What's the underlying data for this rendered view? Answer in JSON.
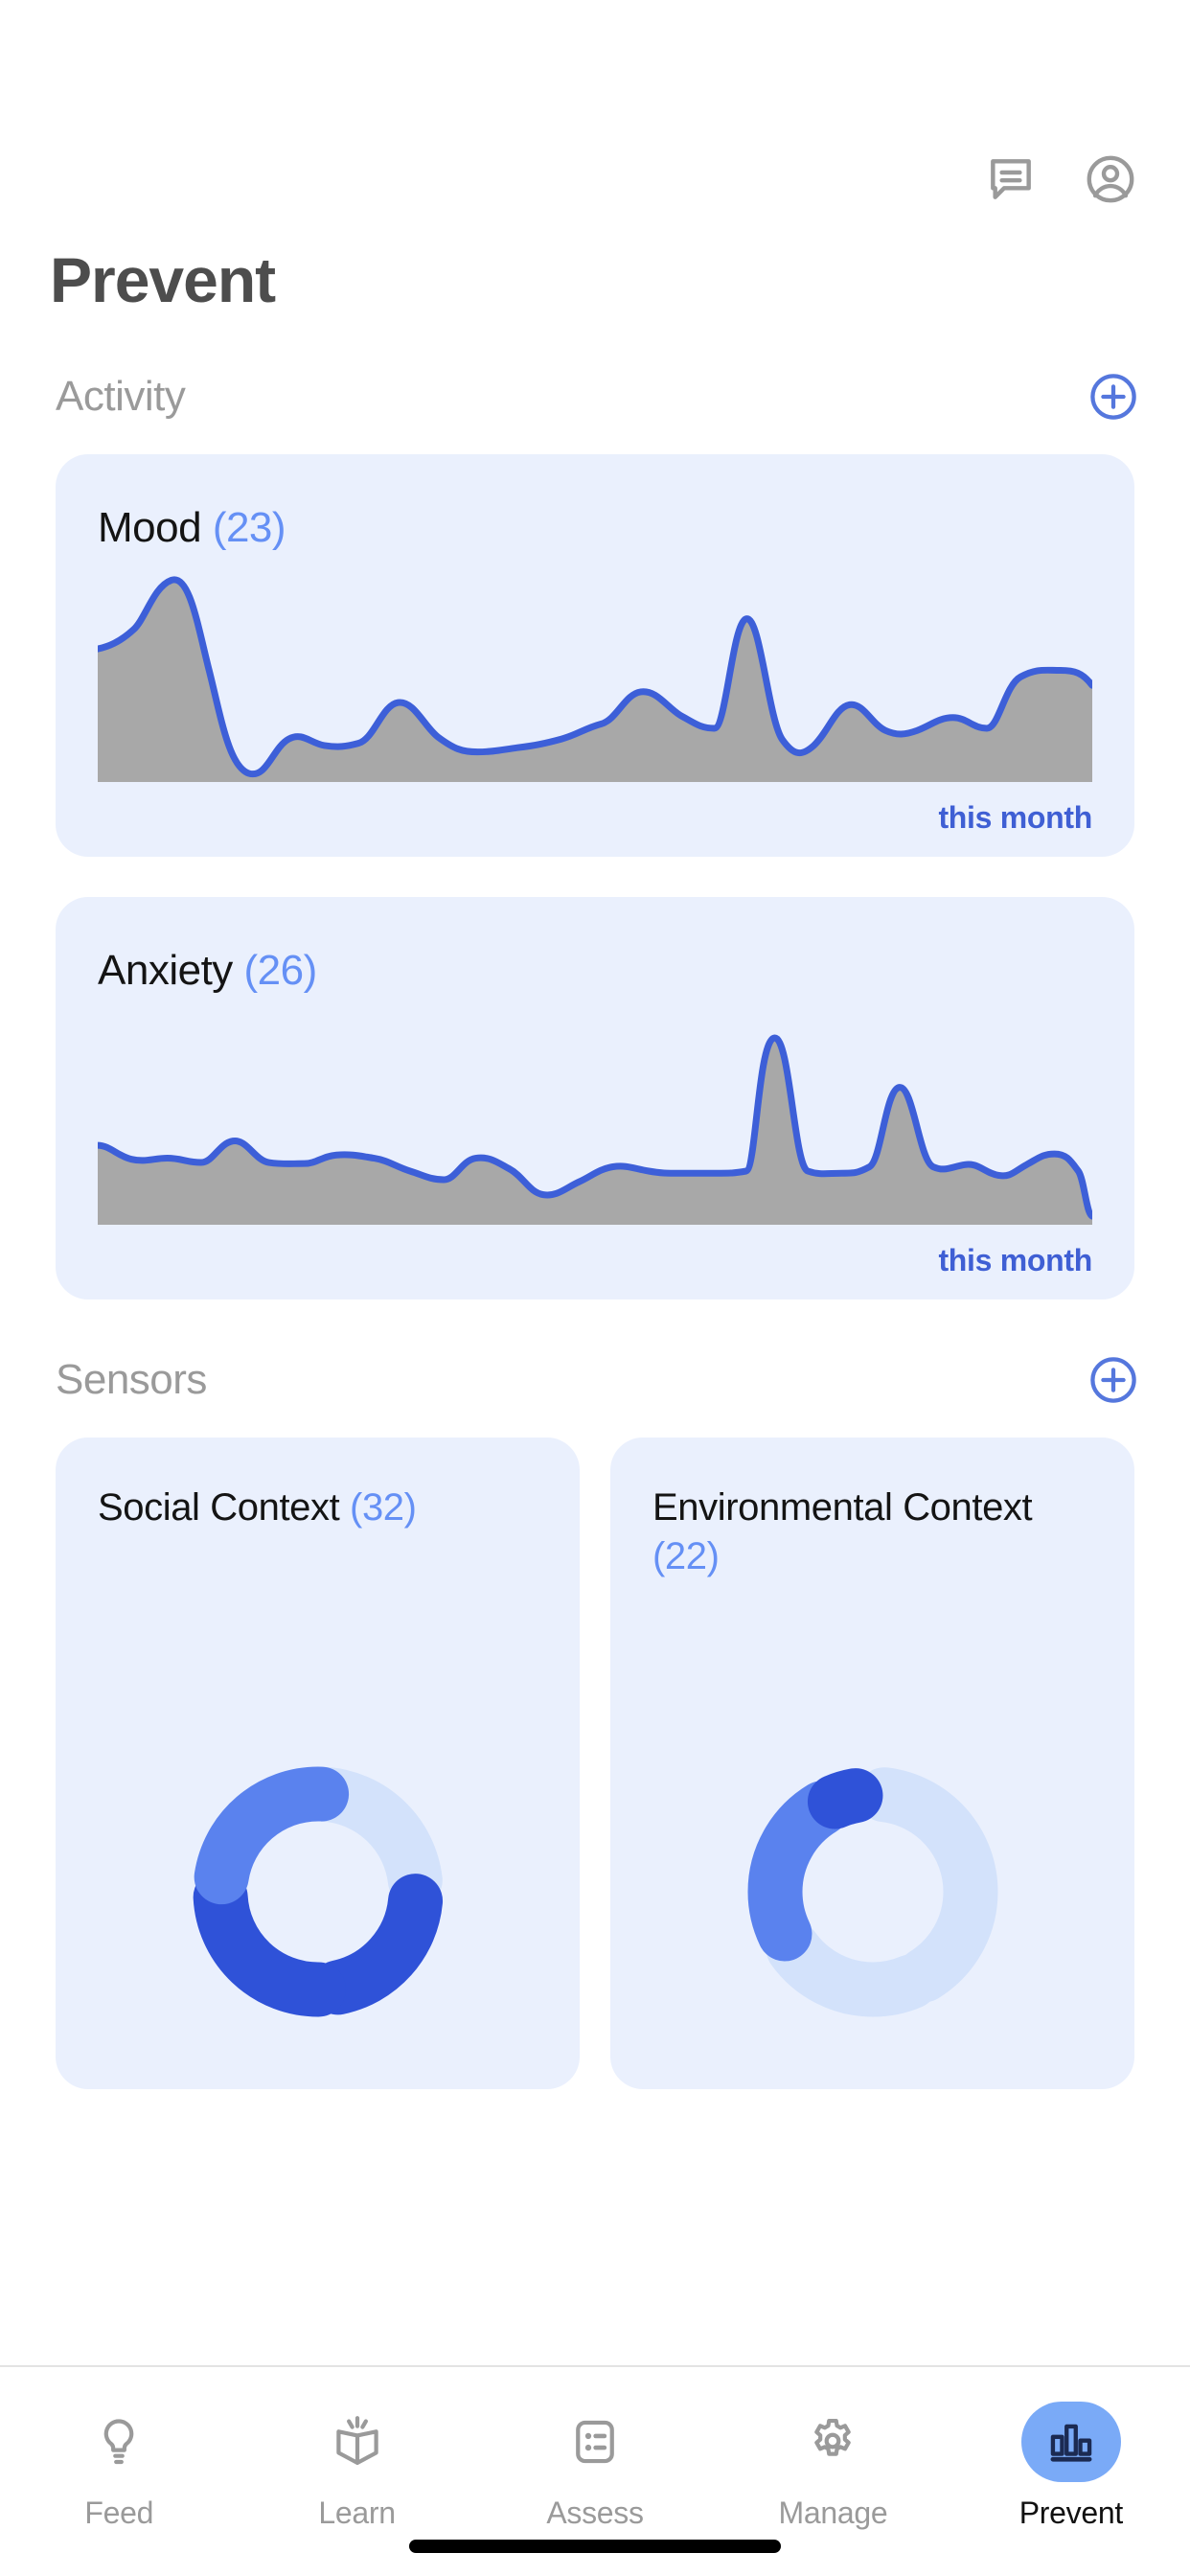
{
  "header": {
    "title": "Prevent",
    "chat_icon": "chat-bubble-icon",
    "account_icon": "account-circle-icon"
  },
  "sections": {
    "activity": {
      "title": "Activity",
      "add_icon": "plus-circle-icon"
    },
    "sensors": {
      "title": "Sensors",
      "add_icon": "plus-circle-icon"
    }
  },
  "activity_cards": [
    {
      "name": "Mood",
      "count": "(23)",
      "footer": "this month"
    },
    {
      "name": "Anxiety",
      "count": "(26)",
      "footer": "this month"
    }
  ],
  "sensor_cards": [
    {
      "name": "Social Context",
      "count": "(32)"
    },
    {
      "name": "Environmental Context",
      "count": "(22)"
    }
  ],
  "bottom_nav": {
    "items": [
      {
        "label": "Feed",
        "icon": "lightbulb-icon",
        "active": false
      },
      {
        "label": "Learn",
        "icon": "open-book-icon",
        "active": false
      },
      {
        "label": "Assess",
        "icon": "list-card-icon",
        "active": false
      },
      {
        "label": "Manage",
        "icon": "gear-icon",
        "active": false
      },
      {
        "label": "Prevent",
        "icon": "bar-chart-icon",
        "active": true
      }
    ]
  },
  "colors": {
    "accent_blue": "#3f5fd4",
    "light_blue": "#6590f5",
    "card_bg": "#eaf0fd",
    "chart_fill": "#a8a8a8",
    "chart_line": "#3d5fd8",
    "donut_dark": "#2f52d8",
    "donut_mid": "#5a82ee",
    "donut_light": "#d3e2fb",
    "title_gray": "#4d4d4d",
    "section_gray": "#9a9a9a",
    "nav_active_bg": "#7aaaf7"
  },
  "chart_data": [
    {
      "type": "area",
      "title": "Mood",
      "count": 23,
      "period": "this month",
      "xlabel": "",
      "ylabel": "",
      "ylim": [
        0,
        100
      ],
      "grid": false,
      "x": [
        0,
        3,
        6,
        9,
        12,
        15,
        18,
        21,
        24,
        27,
        30,
        33,
        36,
        39,
        42,
        45,
        48,
        51,
        54,
        57,
        60,
        63,
        66,
        69,
        72,
        75,
        78,
        81,
        84,
        87,
        90,
        93,
        96,
        100
      ],
      "values": [
        62,
        63,
        66,
        78,
        95,
        68,
        34,
        14,
        5,
        2,
        12,
        22,
        18,
        16,
        34,
        50,
        40,
        25,
        18,
        17,
        19,
        22,
        24,
        38,
        35,
        27,
        32,
        78,
        35,
        17,
        42,
        30,
        26,
        24
      ]
    },
    {
      "type": "area",
      "title": "Anxiety",
      "count": 26,
      "period": "this month",
      "xlabel": "",
      "ylabel": "",
      "ylim": [
        0,
        100
      ],
      "grid": false,
      "x": [
        0,
        3,
        6,
        9,
        12,
        15,
        18,
        21,
        24,
        27,
        30,
        33,
        36,
        39,
        42,
        45,
        48,
        51,
        54,
        57,
        60,
        63,
        66,
        69,
        72,
        75,
        78,
        81,
        84,
        87,
        90,
        93,
        96,
        100
      ],
      "values": [
        36,
        32,
        30,
        34,
        38,
        32,
        33,
        35,
        34,
        30,
        26,
        24,
        30,
        18,
        14,
        19,
        24,
        26,
        24,
        24,
        88,
        24,
        24,
        58,
        26,
        30,
        32,
        26,
        24,
        34,
        30,
        30,
        2,
        2
      ]
    },
    {
      "type": "pie",
      "title": "Social Context",
      "count": 32,
      "labels": [
        "segment-1",
        "segment-2",
        "segment-3",
        "segment-4"
      ],
      "values": [
        24,
        23,
        27,
        26
      ],
      "colors": [
        "#d3e2fb",
        "#2f52d8",
        "#2f52d8",
        "#5a82ee"
      ]
    },
    {
      "type": "pie",
      "title": "Environmental Context",
      "count": 22,
      "labels": [
        "segment-1",
        "segment-2",
        "segment-3",
        "segment-4"
      ],
      "values": [
        41,
        24,
        30,
        5
      ],
      "colors": [
        "#d3e2fb",
        "#d3e2fb",
        "#5a82ee",
        "#2f52d8"
      ]
    }
  ]
}
